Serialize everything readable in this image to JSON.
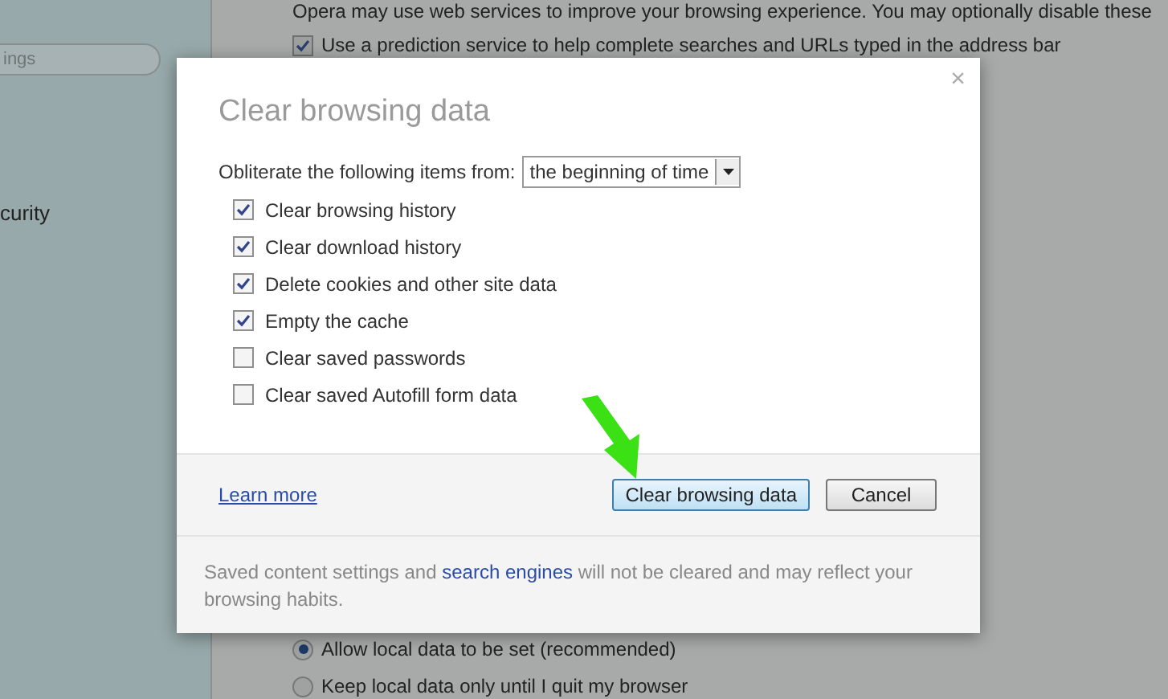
{
  "settings_page": {
    "search_field": {
      "placeholder": "ings"
    },
    "section_label": "curity",
    "intro_text": "Opera may use web services to improve your browsing experience. You may optionally disable these",
    "prediction_option": {
      "label": "Use a prediction service to help complete searches and URLs typed in the address bar",
      "checked": true
    },
    "local_data_options": [
      {
        "label": "Allow local data to be set (recommended)",
        "selected": true
      },
      {
        "label": "Keep local data only until I quit my browser",
        "selected": false
      }
    ]
  },
  "dialog": {
    "title": "Clear browsing data",
    "close": "×",
    "range_label": "Obliterate the following items from:",
    "range_value": "the beginning of time",
    "items": [
      {
        "label": "Clear browsing history",
        "checked": true
      },
      {
        "label": "Clear download history",
        "checked": true
      },
      {
        "label": "Delete cookies and other site data",
        "checked": true
      },
      {
        "label": "Empty the cache",
        "checked": true
      },
      {
        "label": "Clear saved passwords",
        "checked": false
      },
      {
        "label": "Clear saved Autofill form data",
        "checked": false
      }
    ],
    "learn_more": "Learn more",
    "confirm_button": "Clear browsing data",
    "cancel_button": "Cancel",
    "note": {
      "before": "Saved content settings and",
      "link": "search engines",
      "after": "will not be cleared and may reflect your browsing habits."
    }
  }
}
